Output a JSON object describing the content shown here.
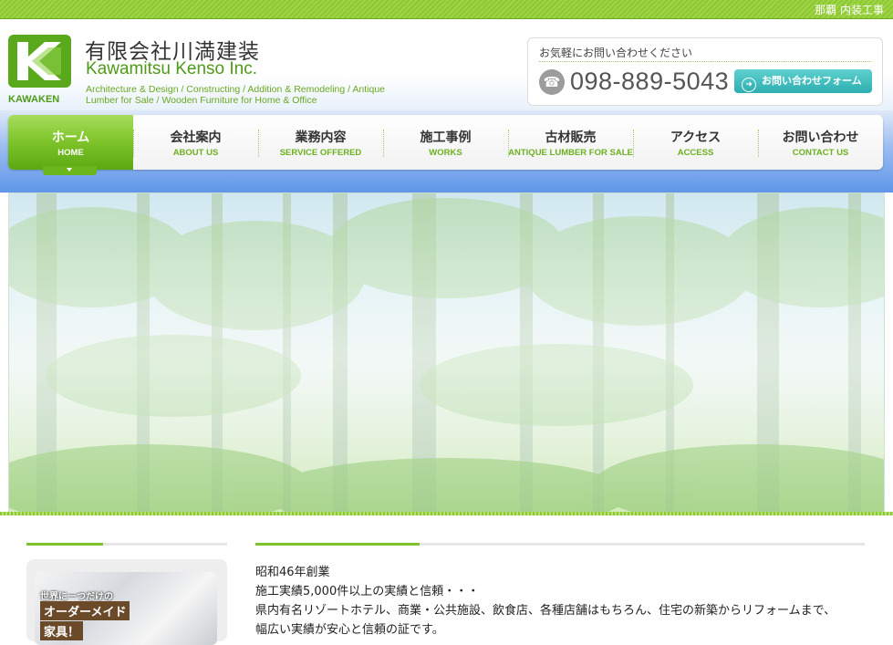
{
  "topbar": {
    "tag": "那覇 内装工事"
  },
  "header": {
    "logo_text": "KAWAKEN",
    "company_jp": "有限会社川満建装",
    "company_en": "Kawamitsu Kenso Inc.",
    "description": "Architecture & Design / Constructing / Addition & Remodeling / Antique Lumber for Sale / Wooden Furniture for Home & Office",
    "contact_label": "お気軽にお問い合わせください",
    "phone_icon": "phone-icon",
    "phone": "098-889-5043",
    "form_button": "お問い合わせフォーム"
  },
  "nav": {
    "items": [
      {
        "jp": "ホーム",
        "en": "HOME",
        "active": true
      },
      {
        "jp": "会社案内",
        "en": "ABOUT US"
      },
      {
        "jp": "業務内容",
        "en": "SERVICE OFFERED"
      },
      {
        "jp": "施工事例",
        "en": "WORKS"
      },
      {
        "jp": "古材販売",
        "en": "ANTIQUE LUMBER FOR SALE"
      },
      {
        "jp": "アクセス",
        "en": "ACCESS"
      },
      {
        "jp": "お問い合わせ",
        "en": "CONTACT US"
      }
    ]
  },
  "sidebar": {
    "banner": {
      "line1": "世界に一つだけの",
      "line2": "オーダーメイド",
      "line3": "家具！"
    }
  },
  "main": {
    "intro": [
      "昭和46年創業",
      "施工実績5,000件以上の実績と信頼・・・",
      "県内有名リゾートホテル、商業・公共施設、飲食店、各種店舗はもちろん、住宅の新築からリフォームまで、",
      "幅広い実績が安心と信頼の証です。"
    ]
  },
  "colors": {
    "brand_green": "#6cb020",
    "accent_teal": "#2eaeb0",
    "nav_blue": "#5f96ea"
  }
}
